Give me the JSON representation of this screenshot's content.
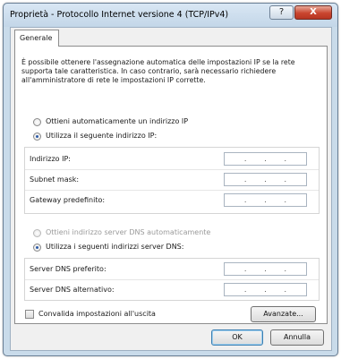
{
  "window": {
    "title": "Proprietà - Protocollo Internet versione 4 (TCP/IPv4)",
    "help_label": "?",
    "close_label": "X"
  },
  "tabs": [
    {
      "label": "Generale"
    }
  ],
  "description": "È possibile ottenere l'assegnazione automatica delle impostazioni IP se la rete supporta tale caratteristica. In caso contrario, sarà necessario richiedere all'amministratore di rete le impostazioni IP corrette.",
  "ip_options": {
    "auto_label": "Ottieni automaticamente un indirizzo IP",
    "manual_label": "Utilizza il seguente indirizzo IP:",
    "selected": "manual"
  },
  "ip_fields": [
    {
      "label": "Indirizzo IP:",
      "value": ". . ."
    },
    {
      "label": "Subnet mask:",
      "value": ". . ."
    },
    {
      "label": "Gateway predefinito:",
      "value": ". . ."
    }
  ],
  "dns_options": {
    "auto_label": "Ottieni indirizzo server DNS automaticamente",
    "manual_label": "Utilizza i seguenti indirizzi server DNS:",
    "selected": "manual",
    "auto_disabled": true
  },
  "dns_fields": [
    {
      "label": "Server DNS preferito:",
      "value": ". . ."
    },
    {
      "label": "Server DNS alternativo:",
      "value": ". . ."
    }
  ],
  "validate_checkbox": {
    "label": "Convalida impostazioni all'uscita",
    "checked": false
  },
  "buttons": {
    "advanced": "Avanzate...",
    "ok": "OK",
    "cancel": "Annulla"
  }
}
